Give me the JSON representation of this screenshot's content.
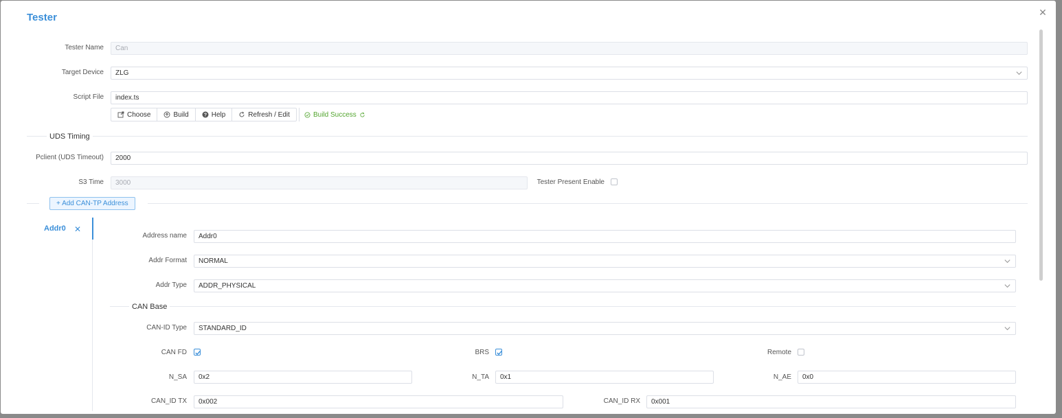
{
  "dialog": {
    "title": "Tester"
  },
  "form": {
    "tester_name": {
      "label": "Tester Name",
      "value": "Can"
    },
    "target_device": {
      "label": "Target Device",
      "value": "ZLG"
    },
    "script_file": {
      "label": "Script File",
      "value": "index.ts"
    },
    "actions": {
      "choose": "Choose",
      "build": "Build",
      "help": "Help",
      "refresh": "Refresh / Edit"
    },
    "build_status": "Build Success"
  },
  "uds_timing": {
    "title": "UDS Timing",
    "pclient": {
      "label": "Pclient (UDS Timeout)",
      "value": "2000"
    },
    "s3_time": {
      "label": "S3 Time",
      "value": "3000"
    },
    "tester_present": {
      "label": "Tester Present Enable",
      "checked": false
    }
  },
  "add_address_label": "Add CAN-TP Address",
  "address_tab": {
    "name": "Addr0"
  },
  "address": {
    "name": {
      "label": "Address name",
      "value": "Addr0"
    },
    "format": {
      "label": "Addr Format",
      "value": "NORMAL"
    },
    "type": {
      "label": "Addr Type",
      "value": "ADDR_PHYSICAL"
    }
  },
  "can_base": {
    "title": "CAN Base",
    "can_id_type": {
      "label": "CAN-ID Type",
      "value": "STANDARD_ID"
    },
    "can_fd": {
      "label": "CAN FD",
      "checked": true
    },
    "brs": {
      "label": "BRS",
      "checked": true
    },
    "remote": {
      "label": "Remote",
      "checked": false
    },
    "n_sa": {
      "label": "N_SA",
      "value": "0x2"
    },
    "n_ta": {
      "label": "N_TA",
      "value": "0x1"
    },
    "n_ae": {
      "label": "N_AE",
      "value": "0x0"
    },
    "can_id_tx": {
      "label": "CAN_ID TX",
      "value": "0x002"
    },
    "can_id_rx": {
      "label": "CAN_ID RX",
      "value": "0x001"
    }
  },
  "colors": {
    "accent": "#3b8fd9",
    "success": "#52a52e"
  }
}
